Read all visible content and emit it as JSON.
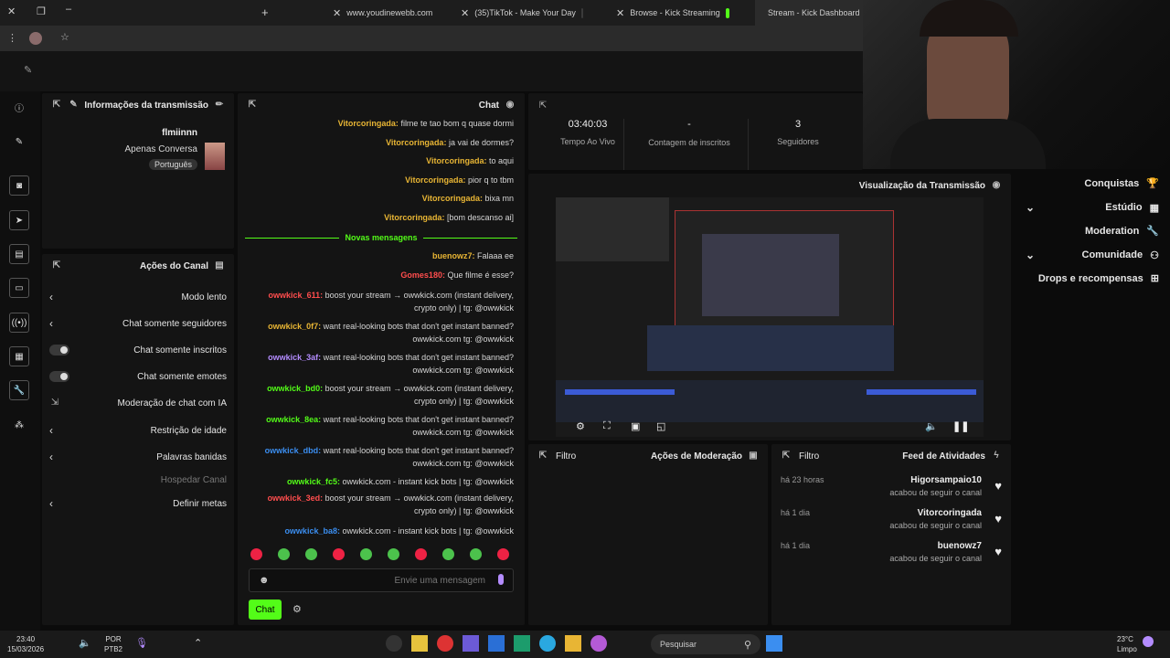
{
  "browser": {
    "tabs": [
      {
        "label": "Stream - Kick Dashboard",
        "active": true
      },
      {
        "label": "Browse - Kick Streaming",
        "active": false
      },
      {
        "label": "(35)TikTok - Make Your Day",
        "active": false
      },
      {
        "label": "www.youdinewebb.com",
        "active": false
      }
    ]
  },
  "info_panel": {
    "title": "Informações da transmissão",
    "streamer": "flmiinnn",
    "category": "Apenas Conversa",
    "language": "Português"
  },
  "actions_panel": {
    "title": "Ações do Canal",
    "items": [
      {
        "label": "Modo lento"
      },
      {
        "label": "Chat somente seguidores"
      },
      {
        "label": "Chat somente inscritos"
      },
      {
        "label": "Chat somente emotes"
      },
      {
        "label": "Moderação de chat com IA"
      },
      {
        "label": "Restrição de idade"
      },
      {
        "label": "Palavras banidas"
      },
      {
        "label": "Hospedar Canal"
      },
      {
        "label": "Definir metas"
      }
    ]
  },
  "chat": {
    "title": "Chat",
    "new_messages": "Novas mensagens",
    "messages": [
      {
        "user": "Vitorcoringada",
        "text": "filme te tao bom q quase dormi"
      },
      {
        "user": "Vitorcoringada",
        "text": "ja vai de dormes?"
      },
      {
        "user": "Vitorcoringada",
        "text": "to aqui"
      },
      {
        "user": "Vitorcoringada",
        "text": "pior q to tbm"
      },
      {
        "user": "Vitorcoringada",
        "text": "bixa mn"
      },
      {
        "user": "Vitorcoringada",
        "text": "[bom descanso ai]"
      },
      {
        "user": "buenowz7",
        "text": "Falaaa ee"
      },
      {
        "user": "Gomes180",
        "text": "Que filme é esse?"
      },
      {
        "user": "owwkick_611",
        "text": "boost your stream → owwkick.com (instant delivery, crypto only) | tg: @owwkick"
      },
      {
        "user": "owwkick_0f7",
        "text": "want real-looking bots that don't get instant banned? owwkick.com tg: @owwkick"
      },
      {
        "user": "owwkick_3af",
        "text": "want real-looking bots that don't get instant banned? owwkick.com tg: @owwkick"
      },
      {
        "user": "owwkick_bd0",
        "text": "boost your stream → owwkick.com (instant delivery, crypto only) | tg: @owwkick"
      },
      {
        "user": "owwkick_8ea",
        "text": "want real-looking bots that don't get instant banned? owwkick.com tg: @owwkick"
      },
      {
        "user": "owwkick_dbd",
        "text": "want real-looking bots that don't get instant banned? owwkick.com tg: @owwkick"
      },
      {
        "user": "owwkick_fc5",
        "text": "owwkick.com - instant kick bots | tg: @owwkick"
      },
      {
        "user": "owwkick_3ed",
        "text": "boost your stream → owwkick.com (instant delivery, crypto only) | tg: @owwkick"
      },
      {
        "user": "owwkick_ba8",
        "text": "owwkick.com - instant kick bots | tg: @owwkick"
      }
    ],
    "input_placeholder": "Envie uma mensagem",
    "send_label": "Chat"
  },
  "stats": [
    {
      "value": "03:40:03",
      "label": "Tempo Ao Vivo"
    },
    {
      "value": "-",
      "label": "Contagem de inscritos"
    },
    {
      "value": "3",
      "label": "Seguidores"
    }
  ],
  "preview": {
    "title": "Visualização da Transmissão"
  },
  "moderation": {
    "title": "Ações de Moderação",
    "filter": "Filtro"
  },
  "feed": {
    "title": "Feed de Atividades",
    "filter": "Filtro",
    "items": [
      {
        "user": "Higorsampaio10",
        "action": "acabou de seguir o canal",
        "time": "há 23 horas"
      },
      {
        "user": "Vitorcoringada",
        "action": "acabou de seguir o canal",
        "time": "há 1 dia"
      },
      {
        "user": "buenowz7",
        "action": "acabou de seguir o canal",
        "time": "há 1 dia"
      }
    ]
  },
  "sidebar": {
    "items": [
      {
        "label": "Conquistas"
      },
      {
        "label": "Estúdio"
      },
      {
        "label": "Moderation"
      },
      {
        "label": "Comunidade"
      },
      {
        "label": "Drops e recompensas"
      }
    ]
  },
  "taskbar": {
    "search": "Pesquisar",
    "weather_temp": "23°C",
    "weather_desc": "Limpo",
    "lang": "POR",
    "kbd": "PTB2",
    "time": "23:40",
    "date": "15/03/2026"
  },
  "colors": {
    "accent": "#53fc18",
    "purple": "#b48cff",
    "red": "#ff4d4d",
    "bg": "#0b0b0b",
    "panel": "#141414"
  }
}
